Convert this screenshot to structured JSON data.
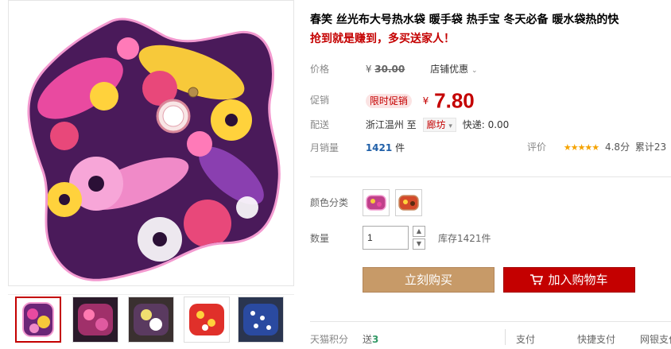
{
  "product": {
    "title": "春笑 丝光布大号热水袋 暖手袋 热手宝 冬天必备 暖水袋热的快",
    "subtitle": "抢到就是赚到，多买送家人！"
  },
  "price": {
    "label": "价格",
    "currency": "¥",
    "original": "30.00",
    "store_coupon": "店铺优惠"
  },
  "promo": {
    "label": "促销",
    "badge": "限时促销",
    "currency": "¥",
    "price": "7.80"
  },
  "shipping": {
    "label": "配送",
    "from": "浙江温州",
    "to_word": "至",
    "city": "廊坊",
    "fee": "快递: 0.00"
  },
  "sales": {
    "label": "月销量",
    "count": "1421",
    "unit": "件"
  },
  "rating": {
    "label": "评价",
    "stars": "★★★★★",
    "score": "4.8分",
    "cumulative": "累计23"
  },
  "sku": {
    "label": "颜色分类"
  },
  "quantity": {
    "label": "数量",
    "value": "1",
    "up": "▲",
    "down": "▼",
    "stock": "库存1421件"
  },
  "actions": {
    "buy_now": "立刻购买",
    "add_cart": "加入购物车"
  },
  "footer": {
    "points_label": "天猫积分",
    "points_prefix": "送",
    "points_value": "3",
    "pay_label": "支付",
    "pay_fast": "快捷支付",
    "pay_bank": "网银支付"
  },
  "colors": {
    "accent_red": "#c40000",
    "buy_button": "#c79a68",
    "link_blue": "#1f5fa8",
    "star": "#f5a300"
  }
}
